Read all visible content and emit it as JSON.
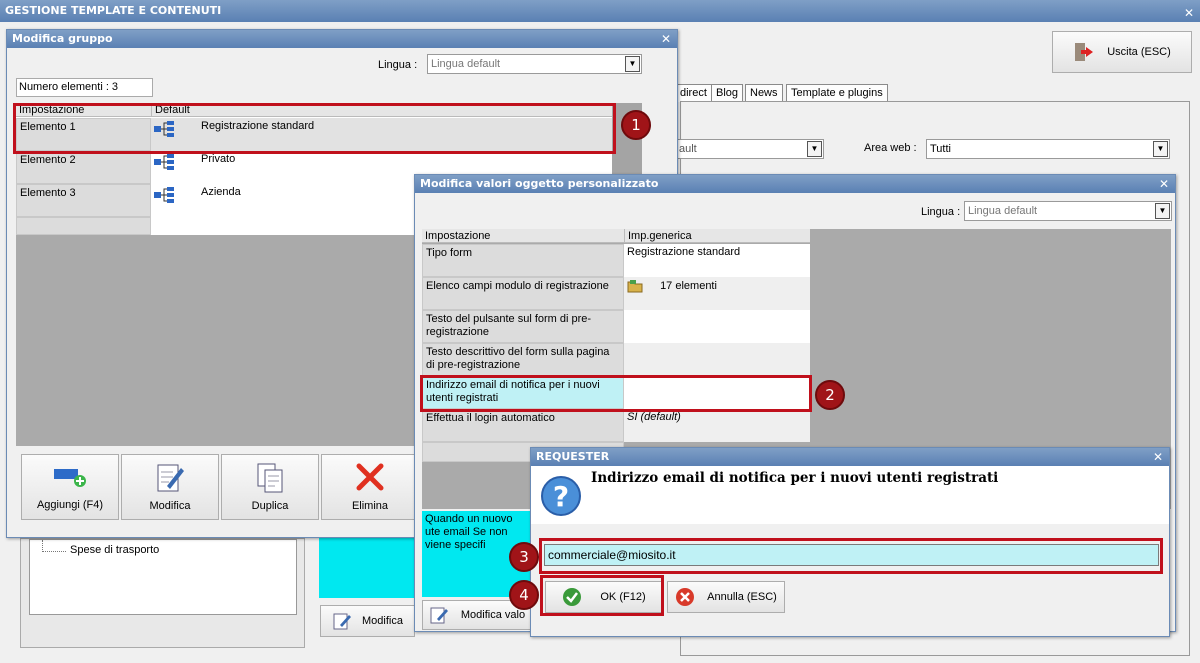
{
  "main_window": {
    "title": "GESTIONE TEMPLATE E CONTENUTI",
    "exit_label": "Uscita (ESC)",
    "tabs": [
      "direct",
      "Blog",
      "News",
      "Template e plugins"
    ],
    "filter_value": "ault",
    "area_web_label": "Area web :",
    "area_web_value": "Tutti",
    "tree_item": "Spese di trasporto",
    "modifica_label": "Modifica"
  },
  "group_dialog": {
    "title": "Modifica gruppo",
    "lingua_label": "Lingua :",
    "lingua_value": "Lingua default",
    "count_label": "Numero elementi : 3",
    "headers": [
      "Impostazione",
      "Default"
    ],
    "rows": [
      {
        "name": "Elemento 1",
        "value": "Registrazione standard"
      },
      {
        "name": "Elemento 2",
        "value": "Privato"
      },
      {
        "name": "Elemento 3",
        "value": "Azienda"
      }
    ],
    "buttons": {
      "add": "Aggiungi (F4)",
      "edit": "Modifica",
      "duplicate": "Duplica",
      "delete": "Elimina"
    }
  },
  "values_dialog": {
    "title": "Modifica valori oggetto personalizzato",
    "lingua_label": "Lingua :",
    "lingua_value": "Lingua default",
    "headers": [
      "Impostazione",
      "Imp.generica"
    ],
    "rows": [
      {
        "name": "Tipo form",
        "value": "Registrazione standard"
      },
      {
        "name": "Elenco campi modulo di registrazione",
        "value": "17 elementi"
      },
      {
        "name": "Testo del pulsante sul form di pre-registrazione",
        "value": ""
      },
      {
        "name": "Testo descrittivo del form sulla pagina di pre-registrazione",
        "value": ""
      },
      {
        "name": "Indirizzo email di notifica per i nuovi utenti registrati",
        "value": ""
      },
      {
        "name": "Effettua il login automatico",
        "value": "SI (default)"
      }
    ],
    "description": "Quando un nuovo ute email Se non viene specifi",
    "edit_button": "Modifica valo"
  },
  "requester": {
    "title": "REQUESTER",
    "question": "Indirizzo email di notifica per i nuovi utenti registrati",
    "input_value": "commerciale@miosito.it",
    "ok_label": "OK (F12)",
    "cancel_label": "Annulla (ESC)"
  },
  "badges": [
    "1",
    "2",
    "3",
    "4"
  ],
  "colors": {
    "accent": "#5a80b3",
    "highlight": "#bff1f5",
    "marker": "#c0101c",
    "cyan_panel": "#00e8f0"
  }
}
